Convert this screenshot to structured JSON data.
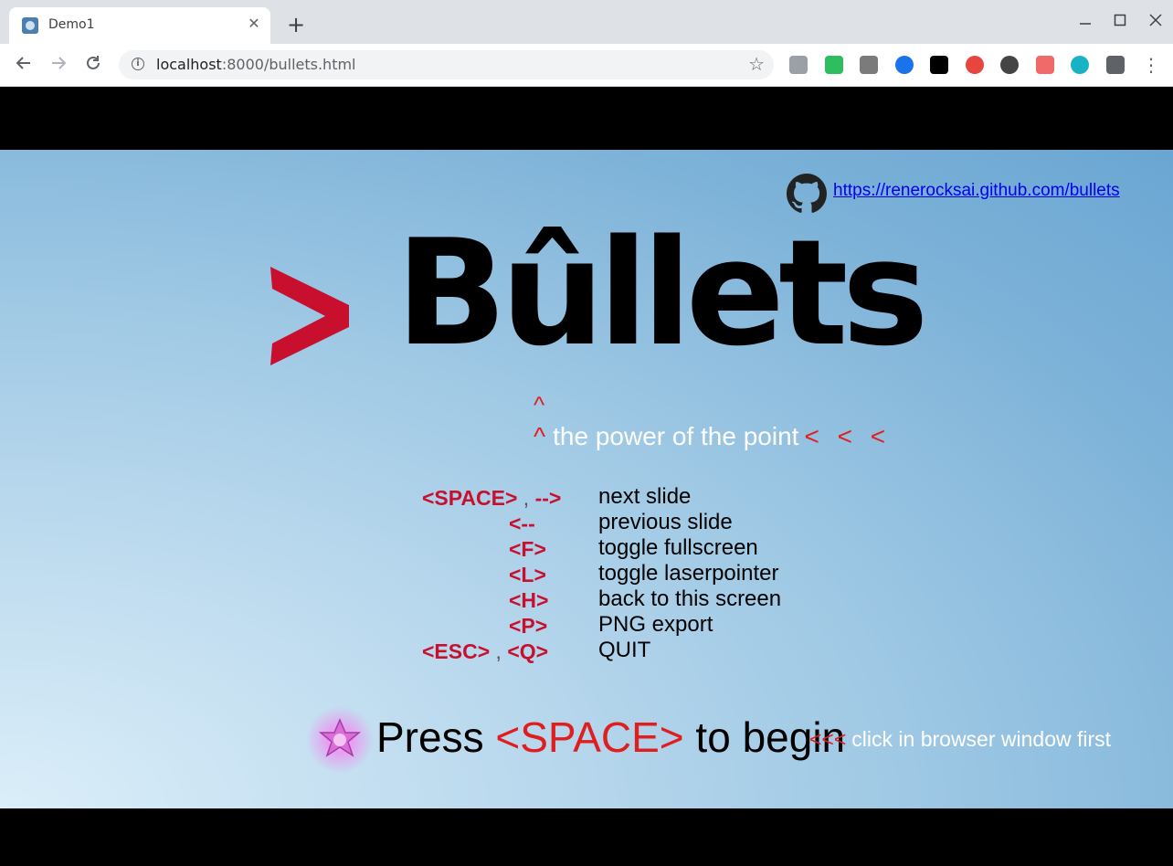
{
  "browser": {
    "tab_title": "Demo1",
    "tab_close": "✕",
    "new_tab": "+",
    "url_host": "localhost",
    "url_rest": ":8000/bullets.html",
    "extensions": [
      {
        "name": "page-icon",
        "color": "#9aa0a6"
      },
      {
        "name": "evernote-icon",
        "color": "#2dbe60"
      },
      {
        "name": "dropbox-icon",
        "color": "#7b7b7b"
      },
      {
        "name": "password-icon",
        "color": "#1a73e8"
      },
      {
        "name": "notion-icon",
        "color": "#000000"
      },
      {
        "name": "circle-red-icon",
        "color": "#e8453c"
      },
      {
        "name": "grey-circle-icon",
        "color": "#444444"
      },
      {
        "name": "arrow-ext-icon",
        "color": "#f06a6a"
      },
      {
        "name": "plus-teal-icon",
        "color": "#17b3c4"
      },
      {
        "name": "puzzle-icon",
        "color": "#5f6368"
      }
    ]
  },
  "slide": {
    "github_link": "https://renerocksai.github.com/bullets",
    "title": "Bûllets",
    "caret": "^",
    "tagline_caret": "^",
    "tagline_text": "the power of the point",
    "tagline_arrows": "< < <",
    "shortcuts": [
      {
        "key": "<SPACE>",
        "sep": " , ",
        "key2": "-->",
        "desc": "next slide"
      },
      {
        "key": "<--",
        "desc": "previous slide"
      },
      {
        "key": "<F>",
        "desc": "toggle fullscreen"
      },
      {
        "key": "<L>",
        "desc": "toggle laserpointer"
      },
      {
        "key": "<H>",
        "desc": "back to this screen"
      },
      {
        "key": "<P>",
        "desc": "PNG export"
      },
      {
        "key": "<ESC>",
        "sep": " , ",
        "key2": "<Q>",
        "desc": "QUIT"
      }
    ],
    "press_before": "Press ",
    "press_key": "<SPACE>",
    "press_after": " to begin",
    "hint_arrows": "<<<",
    "hint_text": "click in browser window first"
  }
}
